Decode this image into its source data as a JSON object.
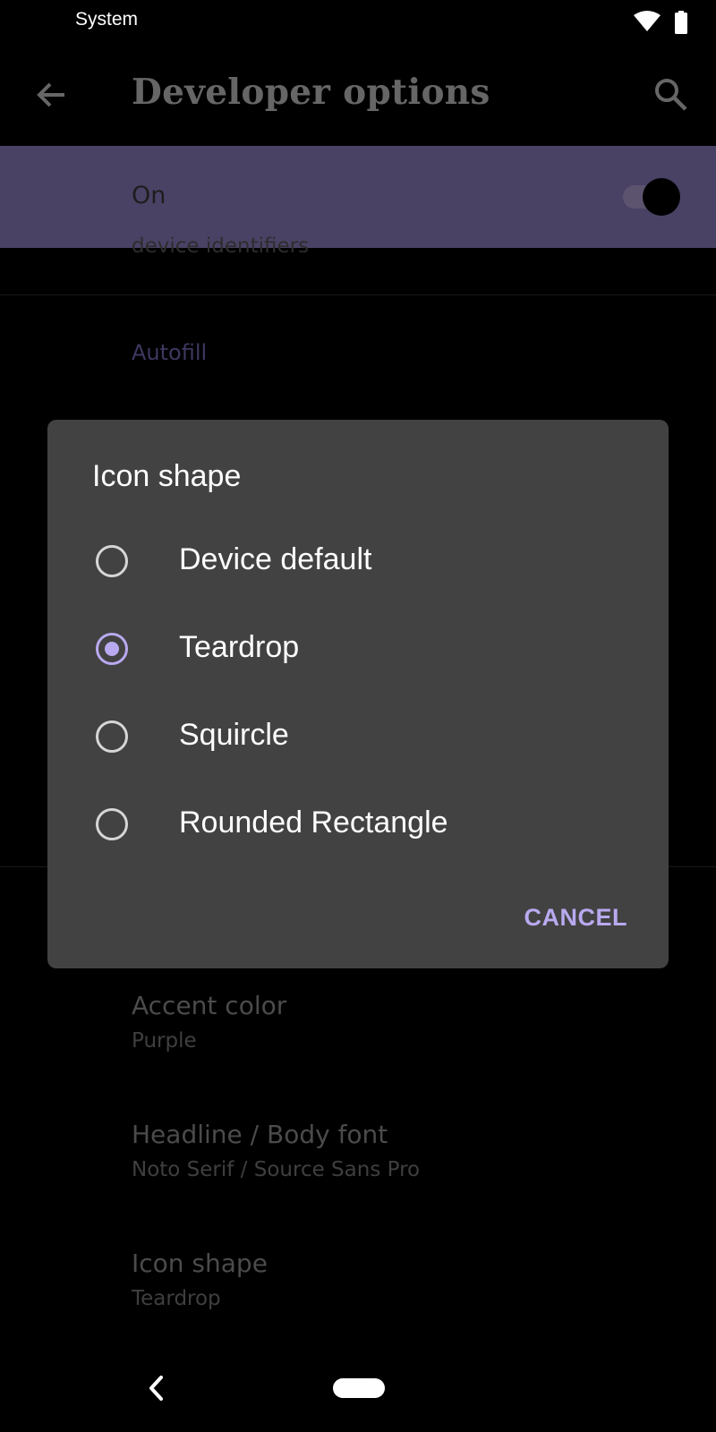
{
  "status_bar": {
    "label": "System"
  },
  "toolbar": {
    "title": "Developer options"
  },
  "master_switch": {
    "label": "On",
    "enabled": true
  },
  "background_list": {
    "partial_item_subtitle": "device identifiers",
    "section_header": "Autofill",
    "items": [
      {
        "title": "Accent color",
        "value": "Purple"
      },
      {
        "title": "Headline / Body font",
        "value": "Noto Serif / Source Sans Pro"
      },
      {
        "title": "Icon shape",
        "value": "Teardrop"
      }
    ]
  },
  "dialog": {
    "title": "Icon shape",
    "options": [
      {
        "label": "Device default",
        "selected": false
      },
      {
        "label": "Teardrop",
        "selected": true
      },
      {
        "label": "Squircle",
        "selected": false
      },
      {
        "label": "Rounded Rectangle",
        "selected": false
      }
    ],
    "cancel_label": "CANCEL"
  },
  "colors": {
    "accent": "#b9a9ef",
    "master_bar": "#4a4265",
    "dialog_bg": "#424242"
  }
}
